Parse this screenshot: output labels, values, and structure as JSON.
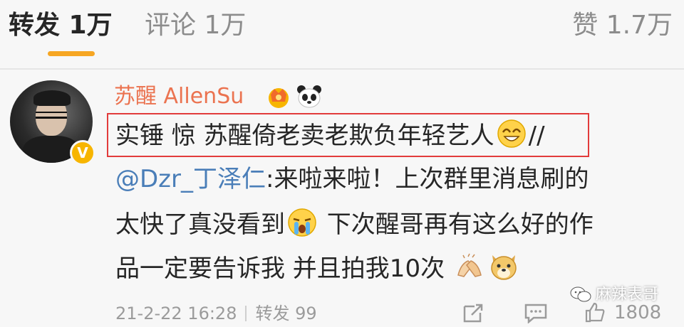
{
  "tabs": {
    "repost": "转发 1万",
    "comment": "评论 1万",
    "like": "赞 1.7万"
  },
  "post": {
    "username": "苏醒 AllenSu",
    "verified_badge": "V",
    "line1": "实锤 惊 苏醒倚老卖老欺负年轻艺人",
    "line1_tail": "//",
    "mention": "@Dzr_丁泽仁",
    "line2_rest": ":来啦来啦！上次群里消息刷的",
    "line3_a": "太快了真没看到",
    "line3_b": " 下次醒哥再有这么好的作",
    "line4": "品一定要告诉我 并且拍我10次"
  },
  "footer": {
    "date": "21-2-22 16:28",
    "repost": "转发 99",
    "like_count": "1808"
  },
  "watermark": "麻辣表哥",
  "icons": {
    "crown": "crown-icon",
    "panda": "panda-icon",
    "grin": "grin-emoji-icon",
    "cry": "crying-emoji-icon",
    "hands": "clapping-hands-icon",
    "doge": "doge-emoji-icon",
    "share": "share-icon",
    "comment": "comment-icon",
    "like": "thumbs-up-icon"
  },
  "colors": {
    "accent": "#f6a623",
    "username": "#eb7350",
    "mention": "#4a7eb8",
    "highlight_box": "#e23b3b"
  }
}
